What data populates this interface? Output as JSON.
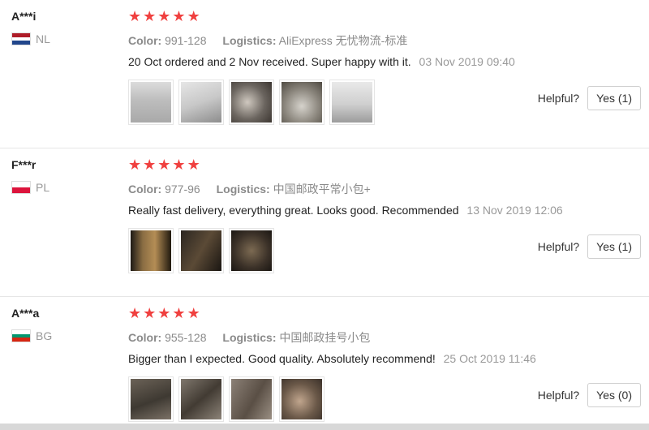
{
  "reviews": [
    {
      "user": "A***i",
      "country": "NL",
      "stars": 5,
      "color_label": "Color:",
      "color_value": "991-128",
      "logistics_label": "Logistics:",
      "logistics_value": "AliExpress 无忧物流-标准",
      "text": "20 Oct ordered and 2 Nov received. Super happy with it.",
      "date": "03 Nov 2019 09:40",
      "photo_count": 5,
      "helpful_label": "Helpful?",
      "yes_label": "Yes (1)"
    },
    {
      "user": "F***r",
      "country": "PL",
      "stars": 5,
      "color_label": "Color:",
      "color_value": "977-96",
      "logistics_label": "Logistics:",
      "logistics_value": "中国邮政平常小包+",
      "text": "Really fast delivery, everything great. Looks good. Recommended",
      "date": "13 Nov 2019 12:06",
      "photo_count": 3,
      "helpful_label": "Helpful?",
      "yes_label": "Yes (1)"
    },
    {
      "user": "A***a",
      "country": "BG",
      "stars": 5,
      "color_label": "Color:",
      "color_value": "955-128",
      "logistics_label": "Logistics:",
      "logistics_value": "中国邮政挂号小包",
      "text": "Bigger than I expected. Good quality. Absolutely recommend!",
      "date": "25 Oct 2019 11:46",
      "photo_count": 4,
      "helpful_label": "Helpful?",
      "yes_label": "Yes (0)"
    }
  ],
  "colors": {
    "star": "#f0403f",
    "flag_nl": [
      "#ae1c28",
      "#ffffff",
      "#21468b"
    ],
    "flag_pl": [
      "#ffffff",
      "#dc143c"
    ],
    "flag_bg": [
      "#ffffff",
      "#00966e",
      "#d62612"
    ]
  }
}
